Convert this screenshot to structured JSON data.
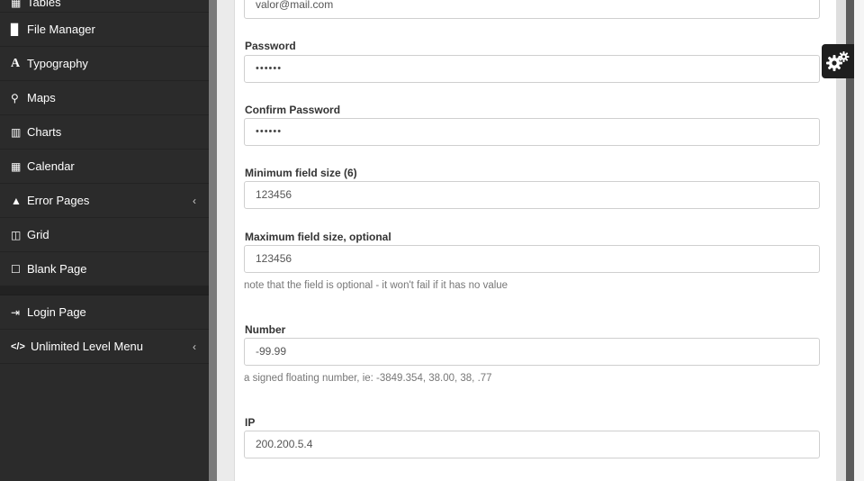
{
  "sidebar": {
    "items": [
      {
        "icon": "table-icon",
        "glyph": "▦",
        "label": "Tables",
        "has_chevron": false
      },
      {
        "icon": "file-icon",
        "glyph": "▉",
        "label": "File Manager",
        "has_chevron": false
      },
      {
        "icon": "font-icon",
        "glyph": "A",
        "label": "Typography",
        "has_chevron": false
      },
      {
        "icon": "map-marker-icon",
        "glyph": "⚲",
        "label": "Maps",
        "has_chevron": false
      },
      {
        "icon": "bar-chart-icon",
        "glyph": "▥",
        "label": "Charts",
        "has_chevron": false
      },
      {
        "icon": "calendar-icon",
        "glyph": "▦",
        "label": "Calendar",
        "has_chevron": false
      },
      {
        "icon": "warning-icon",
        "glyph": "▲",
        "label": "Error Pages",
        "has_chevron": true
      },
      {
        "icon": "columns-icon",
        "glyph": "◫",
        "label": "Grid",
        "has_chevron": false
      },
      {
        "icon": "square-icon",
        "glyph": "☐",
        "label": "Blank Page",
        "has_chevron": false
      }
    ],
    "items_bottom": [
      {
        "icon": "sign-in-icon",
        "glyph": "⇥",
        "label": "Login Page",
        "has_chevron": false
      },
      {
        "icon": "code-icon",
        "glyph": "</>",
        "label": "Unlimited Level Menu",
        "has_chevron": true
      }
    ],
    "chevron_glyph": "‹"
  },
  "form": {
    "email": {
      "value": "valor@mail.com"
    },
    "password": {
      "label": "Password",
      "value": "••••••"
    },
    "confirm_password": {
      "label": "Confirm Password",
      "value": "••••••"
    },
    "min_size": {
      "label": "Minimum field size (6)",
      "value": "123456"
    },
    "max_size": {
      "label": "Maximum field size, optional",
      "value": "123456",
      "help": "note that the field is optional - it won't fail if it has no value"
    },
    "number": {
      "label": "Number",
      "value": "-99.99",
      "help": "a signed floating number, ie: -3849.354, 38.00, 38, .77"
    },
    "ip": {
      "label": "IP",
      "value": "200.200.5.4"
    }
  },
  "settings_tab": {
    "icon": "gears-icon"
  },
  "colors": {
    "sidebar_bg": "#2b2b2b",
    "sidebar_text": "#ffffff",
    "panel_bg": "#ffffff",
    "input_border": "#cfcfcf"
  }
}
